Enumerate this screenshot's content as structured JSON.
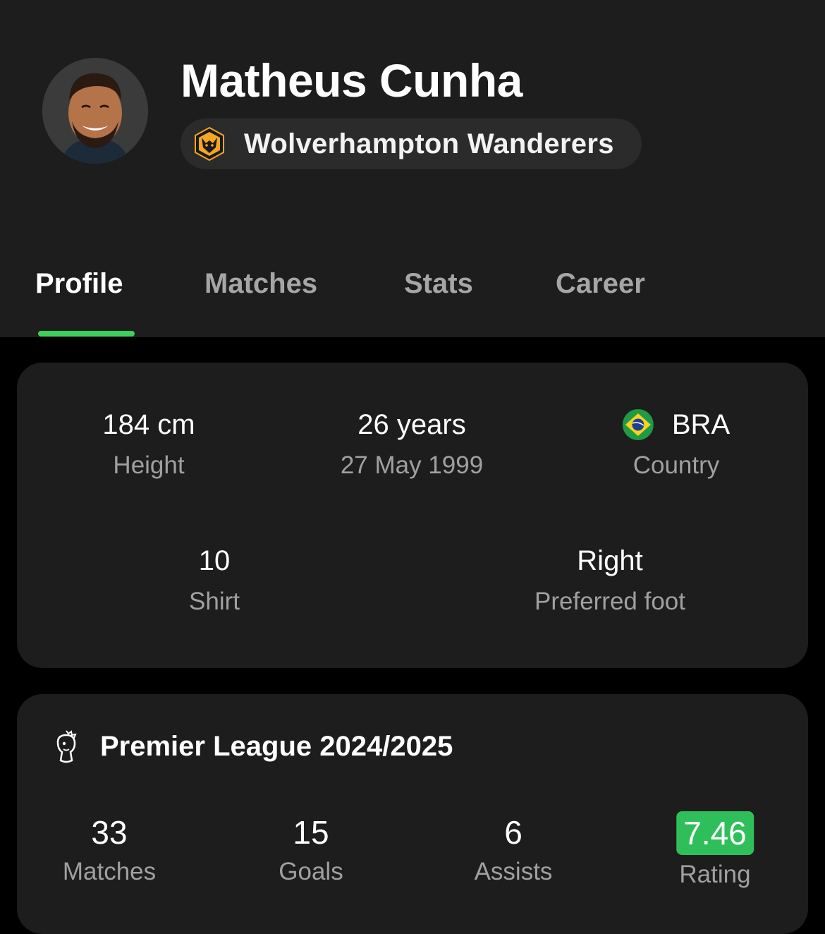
{
  "player": {
    "name": "Matheus Cunha",
    "team": "Wolverhampton Wanderers"
  },
  "tabs": [
    {
      "label": "Profile",
      "active": true
    },
    {
      "label": "Matches",
      "active": false
    },
    {
      "label": "Stats",
      "active": false
    },
    {
      "label": "Career",
      "active": false
    }
  ],
  "info": {
    "height": {
      "value": "184 cm",
      "label": "Height"
    },
    "age": {
      "value": "26 years",
      "label": "27 May 1999"
    },
    "country": {
      "value": "BRA",
      "label": "Country",
      "flag_icon": "brazil-flag-icon"
    },
    "shirt": {
      "value": "10",
      "label": "Shirt"
    },
    "foot": {
      "value": "Right",
      "label": "Preferred foot"
    }
  },
  "season": {
    "title": "Premier League 2024/2025",
    "icon": "premier-league-icon",
    "stats": [
      {
        "value": "33",
        "label": "Matches"
      },
      {
        "value": "15",
        "label": "Goals"
      },
      {
        "value": "6",
        "label": "Assists"
      },
      {
        "value": "7.46",
        "label": "Rating"
      }
    ]
  },
  "colors": {
    "accent": "#3ecf5a",
    "rating_badge": "#2fbf5a",
    "card_bg": "#1d1d1d",
    "page_bg": "#000000"
  }
}
